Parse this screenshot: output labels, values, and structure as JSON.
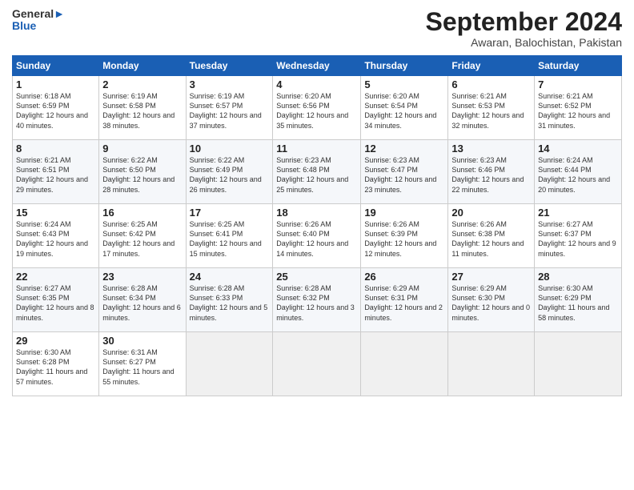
{
  "logo": {
    "line1": "General",
    "line2": "Blue"
  },
  "title": "September 2024",
  "subtitle": "Awaran, Balochistan, Pakistan",
  "days_header": [
    "Sunday",
    "Monday",
    "Tuesday",
    "Wednesday",
    "Thursday",
    "Friday",
    "Saturday"
  ],
  "weeks": [
    [
      {
        "num": "1",
        "rise": "6:18 AM",
        "set": "6:59 PM",
        "daylight": "12 hours and 40 minutes."
      },
      {
        "num": "2",
        "rise": "6:19 AM",
        "set": "6:58 PM",
        "daylight": "12 hours and 38 minutes."
      },
      {
        "num": "3",
        "rise": "6:19 AM",
        "set": "6:57 PM",
        "daylight": "12 hours and 37 minutes."
      },
      {
        "num": "4",
        "rise": "6:20 AM",
        "set": "6:56 PM",
        "daylight": "12 hours and 35 minutes."
      },
      {
        "num": "5",
        "rise": "6:20 AM",
        "set": "6:54 PM",
        "daylight": "12 hours and 34 minutes."
      },
      {
        "num": "6",
        "rise": "6:21 AM",
        "set": "6:53 PM",
        "daylight": "12 hours and 32 minutes."
      },
      {
        "num": "7",
        "rise": "6:21 AM",
        "set": "6:52 PM",
        "daylight": "12 hours and 31 minutes."
      }
    ],
    [
      {
        "num": "8",
        "rise": "6:21 AM",
        "set": "6:51 PM",
        "daylight": "12 hours and 29 minutes."
      },
      {
        "num": "9",
        "rise": "6:22 AM",
        "set": "6:50 PM",
        "daylight": "12 hours and 28 minutes."
      },
      {
        "num": "10",
        "rise": "6:22 AM",
        "set": "6:49 PM",
        "daylight": "12 hours and 26 minutes."
      },
      {
        "num": "11",
        "rise": "6:23 AM",
        "set": "6:48 PM",
        "daylight": "12 hours and 25 minutes."
      },
      {
        "num": "12",
        "rise": "6:23 AM",
        "set": "6:47 PM",
        "daylight": "12 hours and 23 minutes."
      },
      {
        "num": "13",
        "rise": "6:23 AM",
        "set": "6:46 PM",
        "daylight": "12 hours and 22 minutes."
      },
      {
        "num": "14",
        "rise": "6:24 AM",
        "set": "6:44 PM",
        "daylight": "12 hours and 20 minutes."
      }
    ],
    [
      {
        "num": "15",
        "rise": "6:24 AM",
        "set": "6:43 PM",
        "daylight": "12 hours and 19 minutes."
      },
      {
        "num": "16",
        "rise": "6:25 AM",
        "set": "6:42 PM",
        "daylight": "12 hours and 17 minutes."
      },
      {
        "num": "17",
        "rise": "6:25 AM",
        "set": "6:41 PM",
        "daylight": "12 hours and 15 minutes."
      },
      {
        "num": "18",
        "rise": "6:26 AM",
        "set": "6:40 PM",
        "daylight": "12 hours and 14 minutes."
      },
      {
        "num": "19",
        "rise": "6:26 AM",
        "set": "6:39 PM",
        "daylight": "12 hours and 12 minutes."
      },
      {
        "num": "20",
        "rise": "6:26 AM",
        "set": "6:38 PM",
        "daylight": "12 hours and 11 minutes."
      },
      {
        "num": "21",
        "rise": "6:27 AM",
        "set": "6:37 PM",
        "daylight": "12 hours and 9 minutes."
      }
    ],
    [
      {
        "num": "22",
        "rise": "6:27 AM",
        "set": "6:35 PM",
        "daylight": "12 hours and 8 minutes."
      },
      {
        "num": "23",
        "rise": "6:28 AM",
        "set": "6:34 PM",
        "daylight": "12 hours and 6 minutes."
      },
      {
        "num": "24",
        "rise": "6:28 AM",
        "set": "6:33 PM",
        "daylight": "12 hours and 5 minutes."
      },
      {
        "num": "25",
        "rise": "6:28 AM",
        "set": "6:32 PM",
        "daylight": "12 hours and 3 minutes."
      },
      {
        "num": "26",
        "rise": "6:29 AM",
        "set": "6:31 PM",
        "daylight": "12 hours and 2 minutes."
      },
      {
        "num": "27",
        "rise": "6:29 AM",
        "set": "6:30 PM",
        "daylight": "12 hours and 0 minutes."
      },
      {
        "num": "28",
        "rise": "6:30 AM",
        "set": "6:29 PM",
        "daylight": "11 hours and 58 minutes."
      }
    ],
    [
      {
        "num": "29",
        "rise": "6:30 AM",
        "set": "6:28 PM",
        "daylight": "11 hours and 57 minutes."
      },
      {
        "num": "30",
        "rise": "6:31 AM",
        "set": "6:27 PM",
        "daylight": "11 hours and 55 minutes."
      },
      null,
      null,
      null,
      null,
      null
    ]
  ]
}
